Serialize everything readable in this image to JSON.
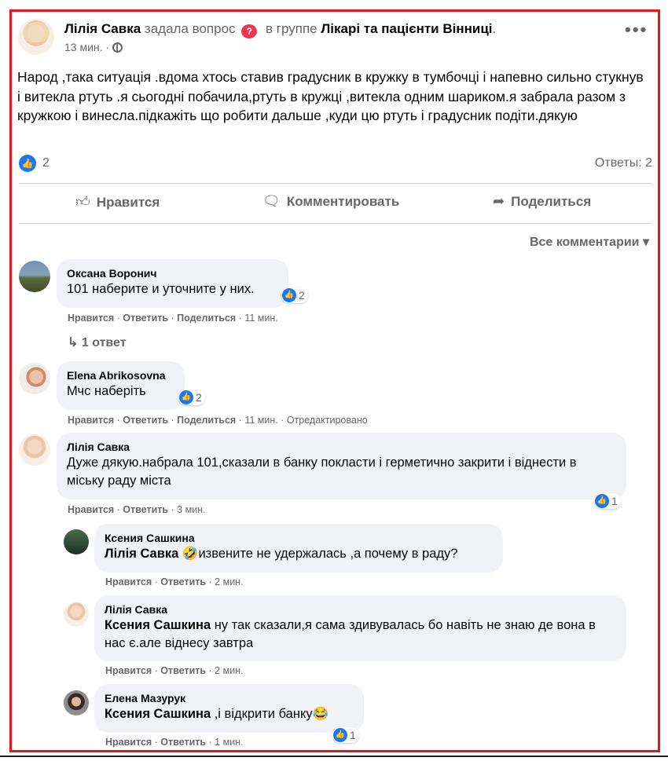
{
  "post": {
    "author": "Лілія Савка",
    "action": "задала вопрос",
    "in_group": "в группе",
    "group": "Лікарі та пацієнти Вінниці",
    "time": "13 мин. ·",
    "text": "Народ ,така ситуація .вдома хтось ставив градусник в кружку в тумбочці і напевно сильно стукнув і витекла ртуть .я сьогодні побачила,ртуть в кружці ,витекла одним шариком.я забрала разом з кружкою і винесла.підкажіть що робити дальше ,куди цю ртуть і градусник подіти.дякую",
    "likes": "2",
    "answers": "Ответы: 2"
  },
  "actions": {
    "like": "Нравится",
    "comment": "Комментировать",
    "share": "Поделиться"
  },
  "all_comments": "Все комментарии",
  "comments": [
    {
      "name": "Оксана Воронич",
      "text": "101 наберите и уточните у них.",
      "reactions": "2",
      "meta_like": "Нравится",
      "meta_reply": "Ответить",
      "meta_share": "Поделиться",
      "meta_time": "11 мин.",
      "replies_link": "1 ответ"
    },
    {
      "name": "Elena Abrikosovna",
      "text": "Мчс наберіть",
      "reactions": "2",
      "meta_like": "Нравится",
      "meta_reply": "Ответить",
      "meta_share": "Поделиться",
      "meta_time": "11 мин.",
      "meta_edited": "Отредактировано"
    },
    {
      "name": "Лілія Савка",
      "text": "Дуже дякую.набрала 101,сказали в банку покласти і герметично закрити і віднести в міську раду міста",
      "reactions": "1",
      "meta_like": "Нравится",
      "meta_reply": "Ответить",
      "meta_time": "3 мин.",
      "replies": [
        {
          "name": "Ксения Сашкина",
          "mention": "Лілія Савка",
          "emoji": "🤣",
          "text": "извените не удержалась ,а почему в раду?",
          "meta_like": "Нравится",
          "meta_reply": "Ответить",
          "meta_time": "2 мин."
        },
        {
          "name": "Лілія Савка",
          "mention": "Ксения Сашкина",
          "text": "ну так сказали,я сама здивувалась бо навіть не знаю де вона в нас є.але віднесу завтра",
          "meta_like": "Нравится",
          "meta_reply": "Ответить",
          "meta_time": "2 мин."
        },
        {
          "name": "Елена Мазурук",
          "mention": "Ксения Сашкина",
          "text": ",і відкрити банку",
          "emoji": "😂",
          "reactions": "1",
          "meta_like": "Нравится",
          "meta_reply": "Ответить",
          "meta_time": "1 мин."
        }
      ]
    }
  ],
  "colors": {
    "accent": "#1a78f2",
    "frame": "#e8151b",
    "bubble": "#f0f2f5",
    "muted": "#65676b"
  },
  "icons": {
    "like": "thumbs-up-icon",
    "comment": "speech-bubble-icon",
    "share": "share-arrow-icon",
    "more": "more-dots-icon",
    "privacy": "globe-icon",
    "question": "question-icon"
  }
}
